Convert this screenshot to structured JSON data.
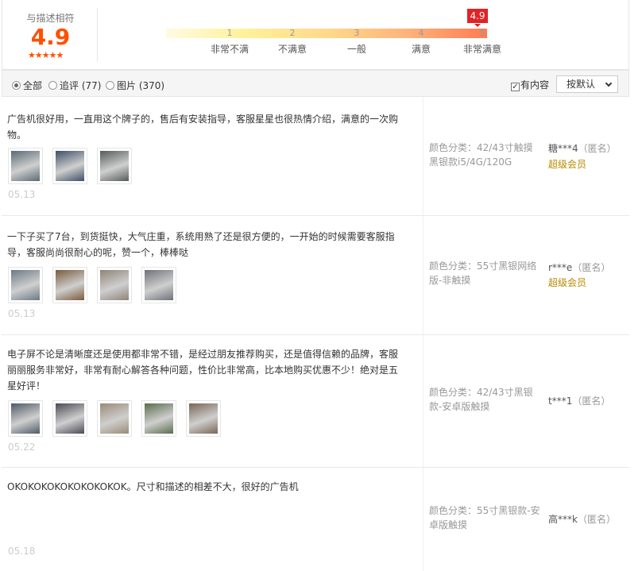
{
  "rating": {
    "label": "与描述相符",
    "score": "4.9",
    "stars": "★★★★★",
    "badge": "4.9",
    "ticks": [
      "1",
      "2",
      "3",
      "4",
      "5"
    ],
    "levels": [
      "非常不满",
      "不满意",
      "一般",
      "满意",
      "非常满意"
    ]
  },
  "filter": {
    "options": [
      {
        "label": "全部",
        "selected": true
      },
      {
        "label": "追评 (77)",
        "selected": false
      },
      {
        "label": "图片 (370)",
        "selected": false
      }
    ],
    "has_content_label": "有内容",
    "has_content_checked": true,
    "sort_label": "按默认"
  },
  "reviews": [
    {
      "text": "广告机很好用，一直用这个牌子的，售后有安装指导，客服星星也很热情介绍，满意的一次购物。",
      "date": "05.13",
      "sku": "颜色分类：42/43寸触摸黑银款i5/4G/120G",
      "user": "糖***4",
      "anon": "（匿名）",
      "vip": "超级会员",
      "thumb_colors": [
        "#5a6a74",
        "#3d4f66",
        "#555b5a"
      ]
    },
    {
      "text": "一下子买了7台，到货挺快，大气庄重，系统用熟了还是很方便的，一开始的时候需要客服指导，客服尚尚很耐心的呢，赞一个，棒棒哒",
      "date": "05.13",
      "sku": "颜色分类：55寸黑银网络版-非触摸",
      "user": "r***e",
      "anon": "（匿名）",
      "vip": "超级会员",
      "thumb_colors": [
        "#6b7a86",
        "#7a5b3b",
        "#8f8478",
        "#6e7278"
      ]
    },
    {
      "text": "电子屏不论是清晰度还是使用都非常不错，是经过朋友推荐购买，还是值得信赖的品牌，客服丽丽服务非常好，非常有耐心解答各种问题，性价比非常高，比本地购买优惠不少！绝对是五星好评！",
      "date": "05.22",
      "sku": "颜色分类：42/43寸黑银款-安卓版触摸",
      "user": "t***1",
      "anon": "（匿名）",
      "vip": "",
      "thumb_colors": [
        "#4f5a66",
        "#4c4a55",
        "#9a8b77",
        "#5b6d4e",
        "#7a6656"
      ]
    },
    {
      "text": "OKOKOKOKOKOKOKOKOK。尺寸和描述的相差不大，很好的广告机",
      "date": "05.18",
      "sku": "颜色分类：55寸黑银款-安卓版触摸",
      "user": "高***k",
      "anon": "（匿名）",
      "vip": "",
      "thumb_colors": []
    }
  ]
}
